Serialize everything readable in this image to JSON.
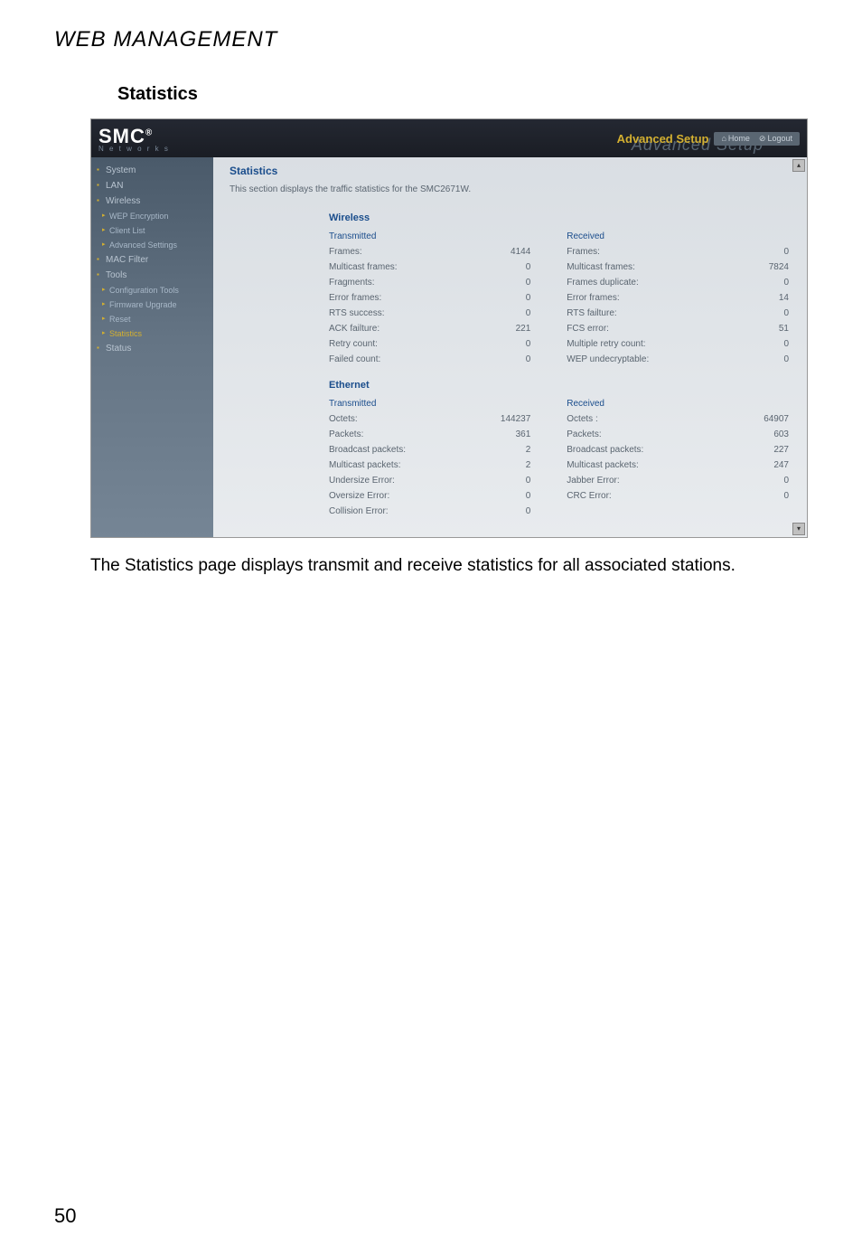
{
  "page": {
    "header": "WEB MANAGEMENT",
    "section_title": "Statistics",
    "body_text": "The Statistics page displays transmit and receive statistics for all associated stations.",
    "page_number": "50"
  },
  "app": {
    "logo": "SMC",
    "logo_reg": "®",
    "logo_sub": "N e t w o r k s",
    "adv_bg": "Advanced Setup",
    "adv_label": "Advanced Setup",
    "home": "Home",
    "logout": "Logout"
  },
  "sidebar": {
    "system": "System",
    "lan": "LAN",
    "wireless": "Wireless",
    "wep": "WEP Encryption",
    "client": "Client List",
    "adv": "Advanced Settings",
    "mac": "MAC Filter",
    "tools": "Tools",
    "config": "Configuration Tools",
    "fw": "Firmware Upgrade",
    "reset": "Reset",
    "stats": "Statistics",
    "status": "Status"
  },
  "content": {
    "title": "Statistics",
    "desc": "This section displays the traffic statistics for the SMC2671W."
  },
  "wireless": {
    "title": "Wireless",
    "tx": "Transmitted",
    "rx": "Received",
    "rows": {
      "frames_l": "Frames:",
      "frames_lv": "4144",
      "frames_r": "Frames:",
      "frames_rv": "0",
      "mcast_l": "Multicast frames:",
      "mcast_lv": "0",
      "mcast_r": "Multicast frames:",
      "mcast_rv": "7824",
      "frag_l": "Fragments:",
      "frag_lv": "0",
      "frag_r": "Frames duplicate:",
      "frag_rv": "0",
      "err_l": "Error frames:",
      "err_lv": "0",
      "err_r": "Error frames:",
      "err_rv": "14",
      "rts_l": "RTS success:",
      "rts_lv": "0",
      "rts_r": "RTS failture:",
      "rts_rv": "0",
      "ack_l": "ACK failture:",
      "ack_lv": "221",
      "ack_r": "FCS error:",
      "ack_rv": "51",
      "retry_l": "Retry count:",
      "retry_lv": "0",
      "retry_r": "Multiple retry count:",
      "retry_rv": "0",
      "fail_l": "Failed count:",
      "fail_lv": "0",
      "fail_r": "WEP undecryptable:",
      "fail_rv": "0"
    }
  },
  "ethernet": {
    "title": "Ethernet",
    "tx": "Transmitted",
    "rx": "Received",
    "rows": {
      "oct_l": "Octets:",
      "oct_lv": "144237",
      "oct_r": "Octets :",
      "oct_rv": "64907",
      "pkt_l": "Packets:",
      "pkt_lv": "361",
      "pkt_r": "Packets:",
      "pkt_rv": "603",
      "bc_l": "Broadcast packets:",
      "bc_lv": "2",
      "bc_r": "Broadcast packets:",
      "bc_rv": "227",
      "mc_l": "Multicast packets:",
      "mc_lv": "2",
      "mc_r": "Multicast packets:",
      "mc_rv": "247",
      "us_l": "Undersize Error:",
      "us_lv": "0",
      "us_r": "Jabber Error:",
      "us_rv": "0",
      "os_l": "Oversize Error:",
      "os_lv": "0",
      "os_r": "CRC Error:",
      "os_rv": "0",
      "col_l": "Collision Error:",
      "col_lv": "0"
    }
  }
}
